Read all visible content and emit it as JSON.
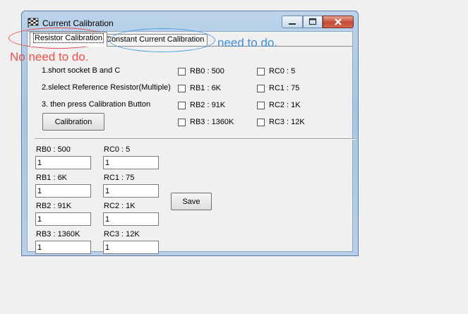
{
  "window": {
    "title": "Current Calibration"
  },
  "tabs": [
    {
      "label": "Resistor Calibration"
    },
    {
      "label": "Constant Current Calibration"
    }
  ],
  "instructions": {
    "step1": "1.short socket B and C",
    "step2": "2.slelect Reference Resistor(Multiple)",
    "step3": "3. then press Calibration Button"
  },
  "calibration_button": "Calibration",
  "checkboxes": {
    "rb0": "RB0 : 500",
    "rb1": "RB1 : 6K",
    "rb2": "RB2 : 91K",
    "rb3": "RB3 : 1360K",
    "rc0": "RC0 : 5",
    "rc1": "RC1 : 75",
    "rc2": "RC2 : 1K",
    "rc3": "RC3 : 12K"
  },
  "fields": {
    "rb0": {
      "label": "RB0 : 500",
      "value": "1"
    },
    "rb1": {
      "label": "RB1 : 6K",
      "value": "1"
    },
    "rb2": {
      "label": "RB2 : 91K",
      "value": "1"
    },
    "rb3": {
      "label": "RB3 : 1360K",
      "value": "1"
    },
    "rc0": {
      "label": "RC0 : 5",
      "value": "1"
    },
    "rc1": {
      "label": "RC1 : 75",
      "value": "1"
    },
    "rc2": {
      "label": "RC2 : 1K",
      "value": "1"
    },
    "rc3": {
      "label": "RC3 : 12K",
      "value": "1"
    }
  },
  "save_button": "Save",
  "annotations": {
    "red": "No need to do.",
    "blue": "need to do."
  },
  "colors": {
    "annotation_red": "#e9504b",
    "annotation_blue": "#3f8fd8",
    "close_button": "#c44a34"
  }
}
